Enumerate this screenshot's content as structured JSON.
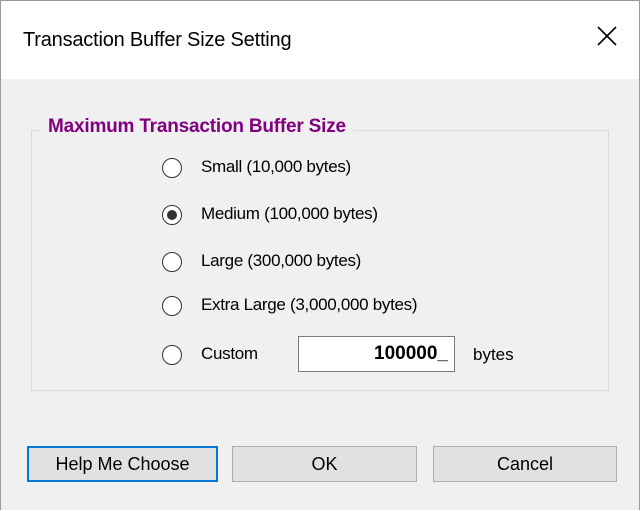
{
  "window": {
    "title": "Transaction Buffer Size Setting",
    "close_icon": "close-x-icon"
  },
  "group": {
    "legend": "Maximum Transaction Buffer Size",
    "legend_color": "#800080"
  },
  "options": [
    {
      "label": "Small (10,000 bytes)",
      "selected": false
    },
    {
      "label": "Medium (100,000 bytes)",
      "selected": true
    },
    {
      "label": "Large (300,000 bytes)",
      "selected": false
    },
    {
      "label": "Extra Large (3,000,000 bytes)",
      "selected": false
    },
    {
      "label": "Custom",
      "selected": false
    }
  ],
  "custom": {
    "value": "100000_",
    "unit": "bytes"
  },
  "buttons": {
    "help": "Help Me Choose",
    "ok": "OK",
    "cancel": "Cancel",
    "focus_color": "#0078d7"
  }
}
